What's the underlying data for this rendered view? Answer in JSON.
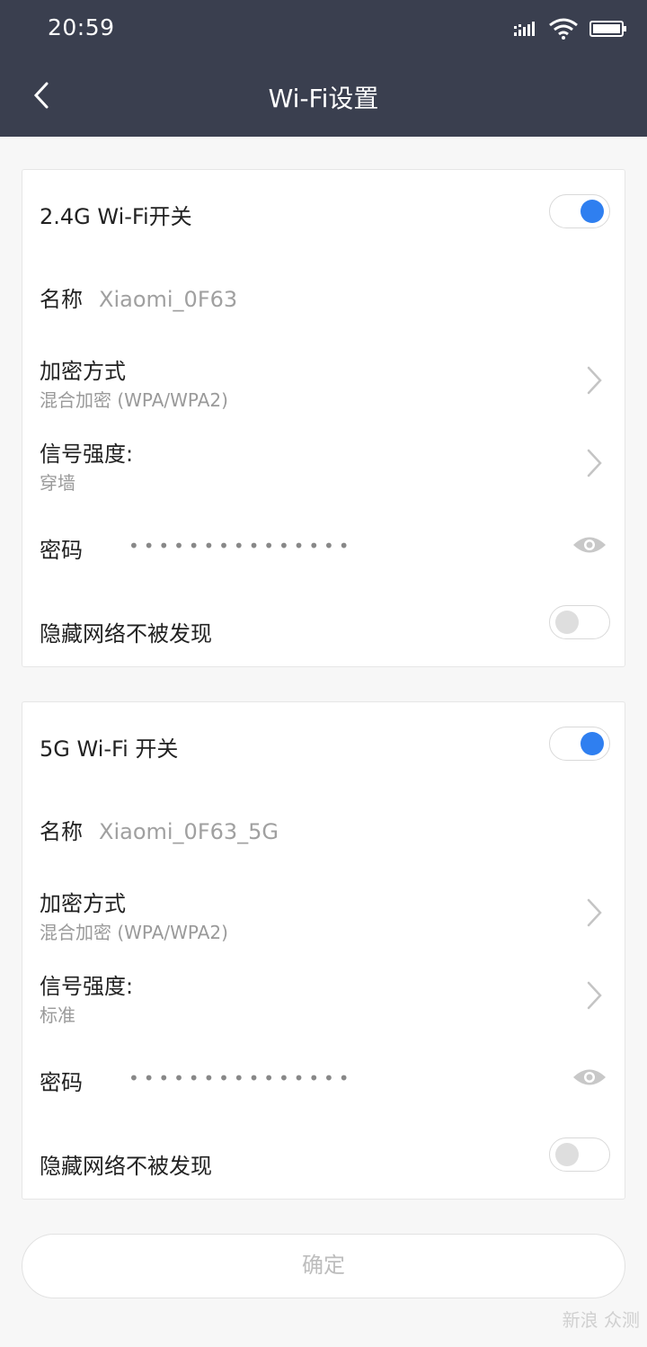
{
  "status": {
    "time": "20:59",
    "icons": [
      "signal-icon",
      "wifi-icon",
      "battery-icon"
    ]
  },
  "nav": {
    "title": "Wi-Fi设置",
    "back_icon": "chevron-left-icon"
  },
  "band_24": {
    "switch_label": "2.4G Wi-Fi开关",
    "switch_on": true,
    "name_label": "名称",
    "name_value": "Xiaomi_0F63",
    "encryption_label": "加密方式",
    "encryption_value": "混合加密 (WPA/WPA2)",
    "signal_label": "信号强度:",
    "signal_value": "穿墙",
    "password_label": "密码",
    "password_mask": "•••••••••••••••",
    "hide_label": "隐藏网络不被发现",
    "hide_on": false
  },
  "band_5": {
    "switch_label": "5G Wi-Fi 开关",
    "switch_on": true,
    "name_label": "名称",
    "name_value": "Xiaomi_0F63_5G",
    "encryption_label": "加密方式",
    "encryption_value": "混合加密 (WPA/WPA2)",
    "signal_label": "信号强度:",
    "signal_value": "标准",
    "password_label": "密码",
    "password_mask": "•••••••••••••••",
    "hide_label": "隐藏网络不被发现",
    "hide_on": false
  },
  "confirm_label": "确定",
  "watermark": "新浪 众测",
  "colors": {
    "header": "#3a3f4f",
    "accent": "#2f7ff0",
    "page_bg": "#f7f7f7"
  }
}
